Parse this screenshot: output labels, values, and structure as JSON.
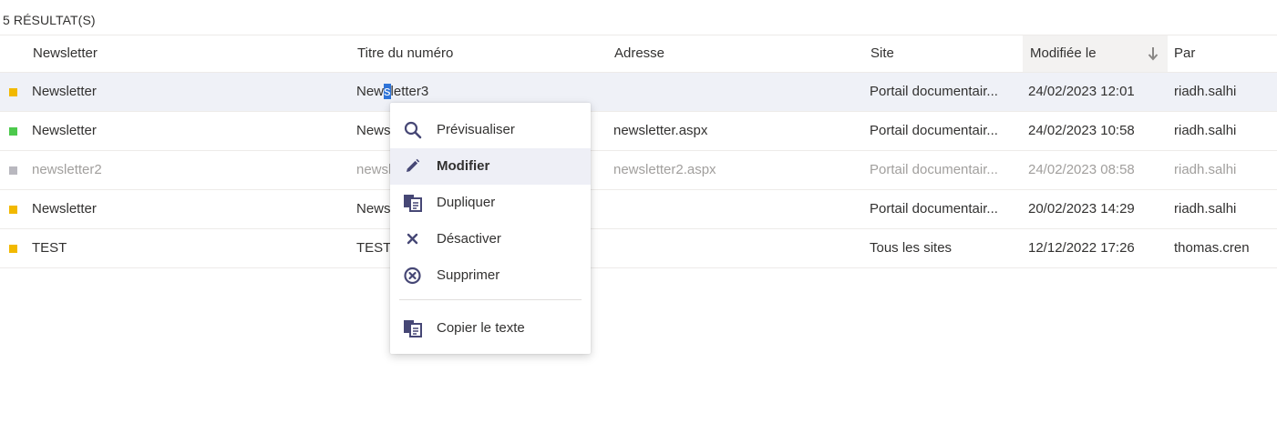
{
  "results_count": "5 RÉSULTAT(S)",
  "columns": {
    "newsletter": "Newsletter",
    "issue_title": "Titre du numéro",
    "address": "Adresse",
    "site": "Site",
    "modified": "Modifiée le",
    "by": "Par"
  },
  "sort": {
    "column": "modified",
    "direction": "descending",
    "icon": "arrow-down-icon"
  },
  "rows": [
    {
      "status_color": "#f2b900",
      "newsletter": "Newsletter",
      "title_before": "New",
      "title_selected": "s",
      "title_after": "letter3",
      "address": "",
      "site": "Portail documentair...",
      "modified": "24/02/2023 12:01",
      "by": "riadh.salhi"
    },
    {
      "status_color": "#4cc94c",
      "newsletter": "Newsletter",
      "title": "Newsletter",
      "address": "newsletter.aspx",
      "site": "Portail documentair...",
      "modified": "24/02/2023 10:58",
      "by": "riadh.salhi"
    },
    {
      "status_color": "#b9b8bf",
      "newsletter": "newsletter2",
      "title": "newsletter2",
      "address": "newsletter2.aspx",
      "site": "Portail documentair...",
      "modified": "24/02/2023 08:58",
      "by": "riadh.salhi"
    },
    {
      "status_color": "#f2b900",
      "newsletter": "Newsletter",
      "title": "Newsletter",
      "address": "",
      "site": "Portail documentair...",
      "modified": "20/02/2023 14:29",
      "by": "riadh.salhi"
    },
    {
      "status_color": "#f2b900",
      "newsletter": "TEST",
      "title": "TEST",
      "address": "",
      "site": "Tous les sites",
      "modified": "12/12/2022 17:26",
      "by": "thomas.cren"
    }
  ],
  "context_menu": {
    "items": [
      {
        "label": "Prévisualiser",
        "icon": "search-icon"
      },
      {
        "label": "Modifier",
        "icon": "pencil-icon"
      },
      {
        "label": "Dupliquer",
        "icon": "duplicate-icon"
      },
      {
        "label": "Désactiver",
        "icon": "close-icon"
      },
      {
        "label": "Supprimer",
        "icon": "delete-circle-icon"
      },
      {
        "label": "Copier le texte",
        "icon": "copy-icon"
      }
    ],
    "hovered": "Modifier"
  },
  "colors": {
    "selected_row": "#eff1f7",
    "text_selection": "#2f74d8",
    "icon": "#464775",
    "disabled_text": "#a19f9d"
  }
}
